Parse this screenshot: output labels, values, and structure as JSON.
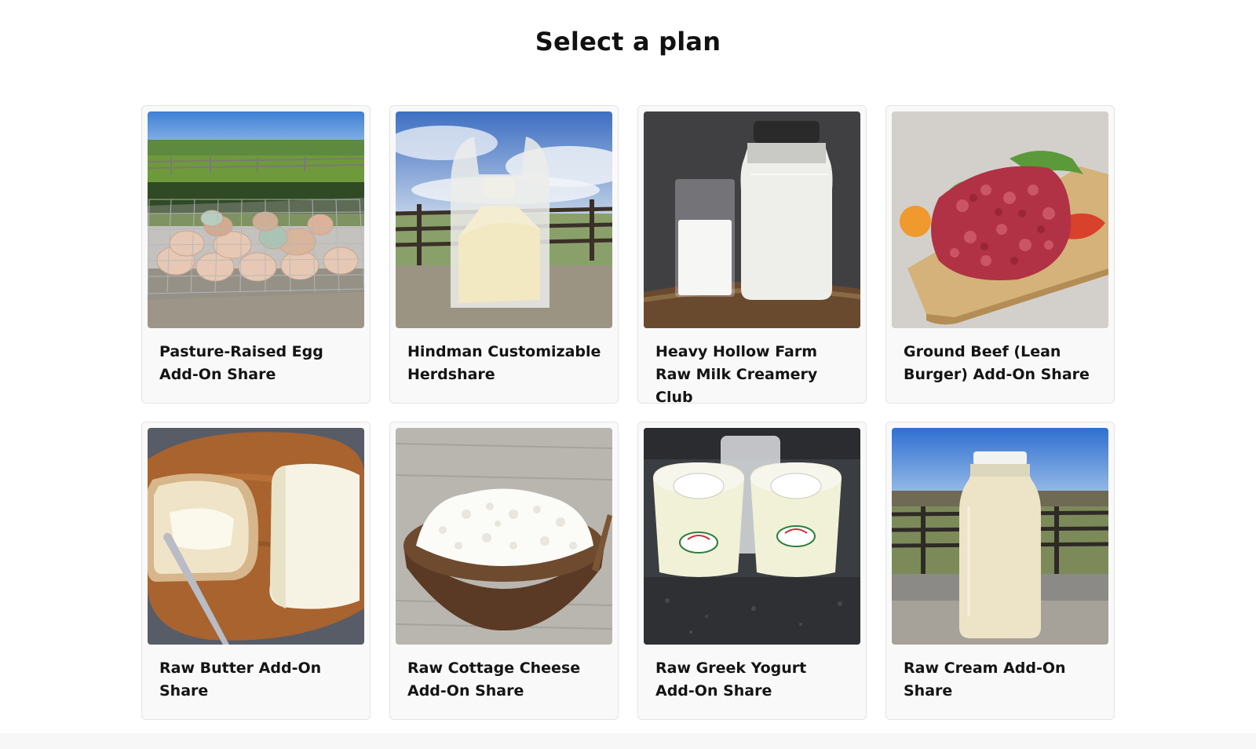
{
  "page": {
    "title": "Select a plan"
  },
  "plans": [
    {
      "title": "Pasture-Raised Egg Add-On Share",
      "image": "eggs-in-wire-basket-photo"
    },
    {
      "title": "Hindman Customizable Herdshare",
      "image": "raw-milk-bag-photo"
    },
    {
      "title": "Heavy Hollow Farm Raw Milk Creamery Club",
      "image": "milk-glass-and-jar-photo"
    },
    {
      "title": "Ground Beef (Lean Burger) Add-On Share",
      "image": "ground-beef-photo"
    },
    {
      "title": "Raw Butter Add-On Share",
      "image": "butter-and-bread-photo"
    },
    {
      "title": "Raw Cottage Cheese Add-On Share",
      "image": "cottage-cheese-bowl-photo"
    },
    {
      "title": "Raw Greek Yogurt Add-On Share",
      "image": "greek-yogurt-cups-photo"
    },
    {
      "title": "Raw Cream Add-On Share",
      "image": "cream-jar-photo"
    }
  ]
}
